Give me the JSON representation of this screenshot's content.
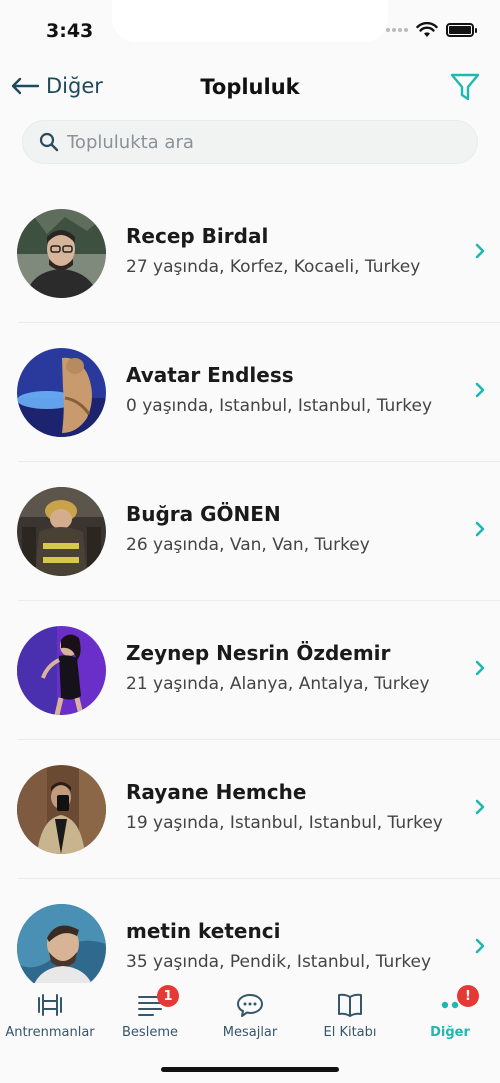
{
  "status": {
    "time": "3:43"
  },
  "nav": {
    "back_label": "Diğer",
    "title": "Topluluk"
  },
  "search": {
    "placeholder": "Toplulukta ara"
  },
  "members": [
    {
      "name": "Recep Birdal",
      "detail": "27 yaşında, Korfez, Kocaeli, Turkey"
    },
    {
      "name": "Avatar Endless",
      "detail": "0 yaşında, Istanbul, Istanbul, Turkey"
    },
    {
      "name": "Buğra GÖNEN",
      "detail": "26 yaşında, Van, Van, Turkey"
    },
    {
      "name": "Zeynep Nesrin Özdemir",
      "detail": "21 yaşında, Alanya, Antalya, Turkey"
    },
    {
      "name": "Rayane Hemche",
      "detail": "19 yaşında, Istanbul, Istanbul, Turkey"
    },
    {
      "name": "metin ketenci",
      "detail": "35 yaşında, Pendik, Istanbul, Turkey"
    }
  ],
  "tabs": [
    {
      "label": "Antrenmanlar",
      "icon": "dumbbell-icon"
    },
    {
      "label": "Besleme",
      "icon": "list-icon",
      "badge": "1"
    },
    {
      "label": "Mesajlar",
      "icon": "chat-icon"
    },
    {
      "label": "El Kitabı",
      "icon": "book-icon"
    },
    {
      "label": "Diğer",
      "icon": "more-icon",
      "badge": "!"
    }
  ],
  "colors": {
    "accent": "#1fb8b0",
    "badge": "#e53935",
    "nav_text": "#1e4a5e"
  }
}
